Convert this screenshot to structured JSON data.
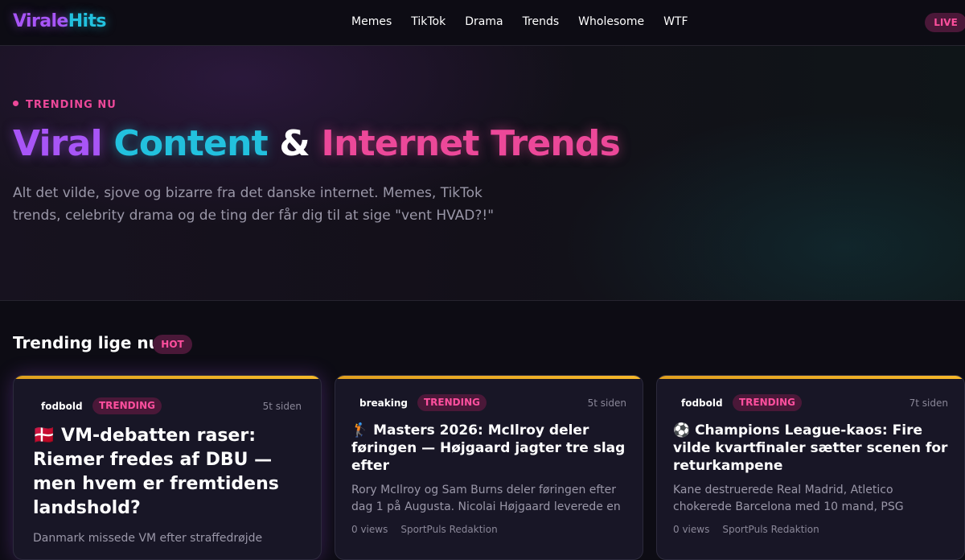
{
  "nav": {
    "logo_part1": "Virale",
    "logo_part2": "Hits",
    "links": [
      "Memes",
      "TikTok",
      "Drama",
      "Trends",
      "Wholesome",
      "WTF"
    ],
    "live_label": "LIVE"
  },
  "hero": {
    "eyebrow": "TRENDING NU",
    "title_w1": "Viral",
    "title_w2": "Content",
    "title_w3": "&",
    "title_w4": "Internet Trends",
    "subtitle": "Alt det vilde, sjove og bizarre fra det danske internet. Memes, TikTok trends, celebrity drama og de ting der får dig til at sige \"vent HVAD?!\""
  },
  "section": {
    "title": "Trending lige nu",
    "badge": "HOT"
  },
  "cards": [
    {
      "category": "fodbold",
      "tag": "TRENDING",
      "time": "5t siden",
      "title": "🇩🇰 VM-debatten raser: Riemer fredes af DBU — men hvem er fremtidens landshold?",
      "excerpt": "Danmark missede VM efter straffedrøjde",
      "views": "",
      "author": ""
    },
    {
      "category": "breaking",
      "tag": "TRENDING",
      "time": "5t siden",
      "title": "🏌️ Masters 2026: McIlroy deler føringen — Højgaard jagter tre slag efter",
      "excerpt": "Rory McIlroy og Sam Burns deler føringen efter dag 1 på Augusta. Nicolai Højgaard leverede en stærk…",
      "views": "0 views",
      "author": "SportPuls Redaktion"
    },
    {
      "category": "fodbold",
      "tag": "TRENDING",
      "time": "7t siden",
      "title": "⚽ Champions League-kaos: Fire vilde kvartfinaler sætter scenen for returkampene",
      "excerpt": "Kane destruerede Real Madrid, Atletico chokerede Barcelona med 10 mand, PSG ydmygede Liverpoo…",
      "views": "0 views",
      "author": "SportPuls Redaktion"
    }
  ],
  "colors": {
    "purple": "#a855f7",
    "cyan": "#22c1de",
    "pink": "#ec4899",
    "gold": "#f5b82a"
  }
}
